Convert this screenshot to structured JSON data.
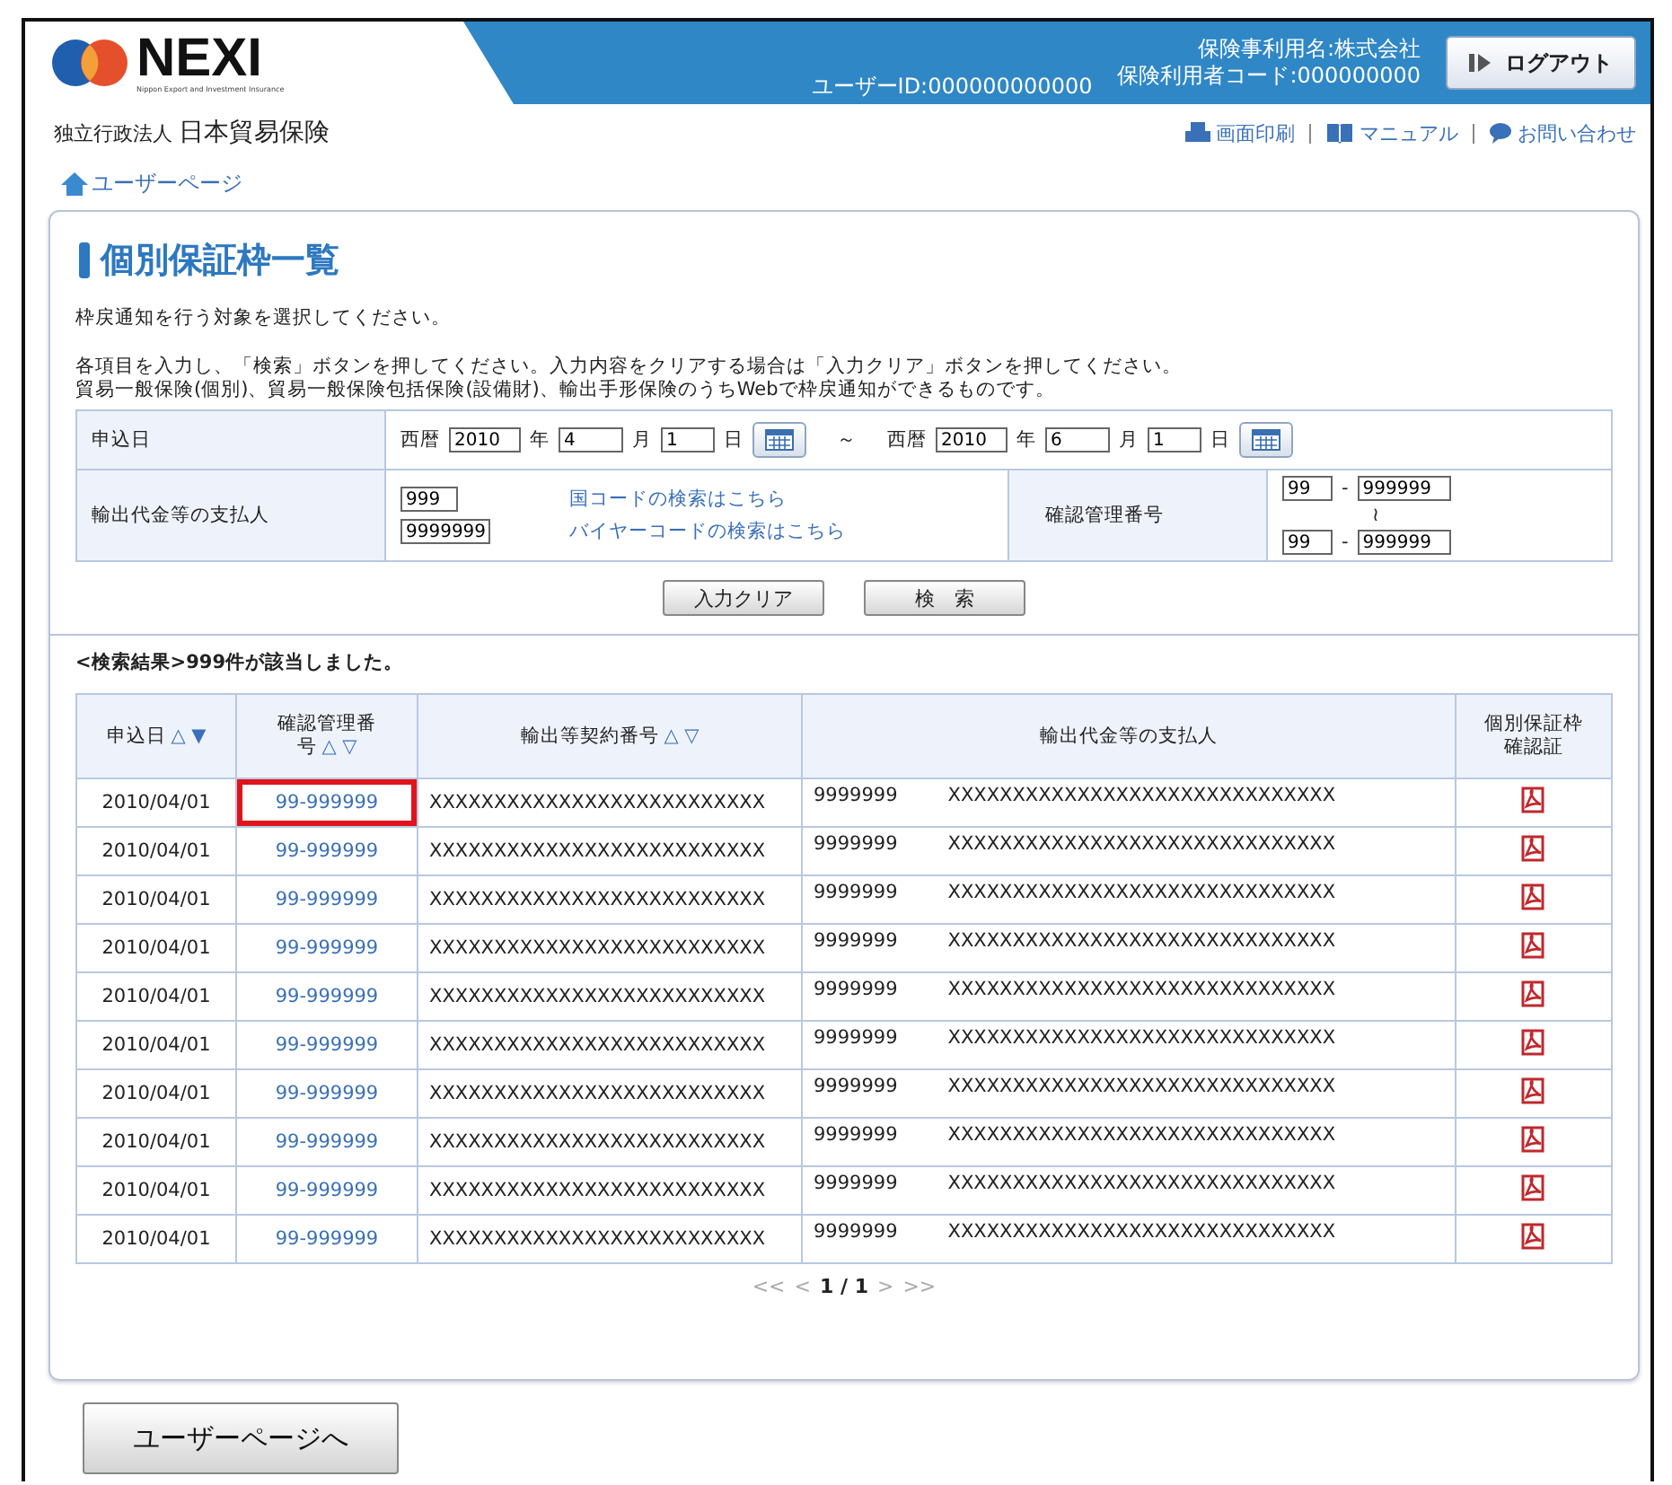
{
  "header": {
    "logo": "NEXI",
    "logo_subtitle": "Nippon Export and Investment Insurance",
    "org_prefix": "独立行政法人",
    "org_name": "日本貿易保険",
    "user_id": "ユーザーID:000000000000",
    "user_name": "保険事利用名:株式会社",
    "user_code": "保険利用者コード:000000000",
    "logout": "ログアウト",
    "links": [
      {
        "kind": "print",
        "label": "画面印刷"
      },
      {
        "kind": "manual",
        "label": "マニュアル"
      },
      {
        "kind": "contact",
        "label": "お問い合わせ"
      }
    ]
  },
  "breadcrumb": "ユーザーページ",
  "title": "個別保証枠一覧",
  "intro": "枠戻通知を行う対象を選択してください。",
  "notes": [
    "各項目を入力し、「検索」ボタンを押してください。入力内容をクリアする場合は「入力クリア」ボタンを押してください。",
    "貿易一般保険(個別)、貿易一般保険包括保険(設備財)、輸出手形保険のうちWebで枠戻通知ができるものです。"
  ],
  "search": {
    "date_label": "申込日",
    "date_from": {
      "era": "西暦",
      "year": "2010",
      "year_unit": "年",
      "month": "4",
      "month_unit": "月",
      "day": "1",
      "day_unit": "日"
    },
    "range_sep": "～",
    "date_to": {
      "era": "西暦",
      "year": "2010",
      "year_unit": "年",
      "month": "6",
      "month_unit": "月",
      "day": "1",
      "day_unit": "日"
    },
    "payer_label": "輸出代金等の支払人",
    "country_code": "999",
    "country_link": "国コードの検索はこちら",
    "buyer_code": "9999999",
    "buyer_link": "バイヤーコードの検索はこちら",
    "confirm_label": "確認管理番号",
    "confirm_from": [
      "99",
      "999999"
    ],
    "confirm_sep": "-",
    "confirm_range": "≀",
    "confirm_to": [
      "99",
      "999999"
    ]
  },
  "buttons": [
    "入力クリア",
    "検　索"
  ],
  "result_summary": "<検索結果>999件が該当しました。",
  "table": {
    "columns": [
      {
        "label": "申込日",
        "sort": "△ ▼"
      },
      {
        "label": "確認管理番号",
        "sort": "△ ▽"
      },
      {
        "label": "輸出等契約番号",
        "sort": "△ ▽"
      },
      {
        "label": "輸出代金等の支払人"
      },
      {
        "label": "個別保証枠確認証"
      }
    ],
    "rows": [
      {
        "date": "2010/04/01",
        "number": "99-999999",
        "contract": "XXXXXXXXXXXXXXXXXXXXXXXXXX",
        "payer_code": "9999999",
        "payer_name": "XXXXXXXXXXXXXXXXXXXXXXXXXXXXXX",
        "highlighted": true
      },
      {
        "date": "2010/04/01",
        "number": "99-999999",
        "contract": "XXXXXXXXXXXXXXXXXXXXXXXXXX",
        "payer_code": "9999999",
        "payer_name": "XXXXXXXXXXXXXXXXXXXXXXXXXXXXXX",
        "highlighted": false
      },
      {
        "date": "2010/04/01",
        "number": "99-999999",
        "contract": "XXXXXXXXXXXXXXXXXXXXXXXXXX",
        "payer_code": "9999999",
        "payer_name": "XXXXXXXXXXXXXXXXXXXXXXXXXXXXXX",
        "highlighted": false
      },
      {
        "date": "2010/04/01",
        "number": "99-999999",
        "contract": "XXXXXXXXXXXXXXXXXXXXXXXXXX",
        "payer_code": "9999999",
        "payer_name": "XXXXXXXXXXXXXXXXXXXXXXXXXXXXXX",
        "highlighted": false
      },
      {
        "date": "2010/04/01",
        "number": "99-999999",
        "contract": "XXXXXXXXXXXXXXXXXXXXXXXXXX",
        "payer_code": "9999999",
        "payer_name": "XXXXXXXXXXXXXXXXXXXXXXXXXXXXXX",
        "highlighted": false
      },
      {
        "date": "2010/04/01",
        "number": "99-999999",
        "contract": "XXXXXXXXXXXXXXXXXXXXXXXXXX",
        "payer_code": "9999999",
        "payer_name": "XXXXXXXXXXXXXXXXXXXXXXXXXXXXXX",
        "highlighted": false
      },
      {
        "date": "2010/04/01",
        "number": "99-999999",
        "contract": "XXXXXXXXXXXXXXXXXXXXXXXXXX",
        "payer_code": "9999999",
        "payer_name": "XXXXXXXXXXXXXXXXXXXXXXXXXXXXXX",
        "highlighted": false
      },
      {
        "date": "2010/04/01",
        "number": "99-999999",
        "contract": "XXXXXXXXXXXXXXXXXXXXXXXXXX",
        "payer_code": "9999999",
        "payer_name": "XXXXXXXXXXXXXXXXXXXXXXXXXXXXXX",
        "highlighted": false
      },
      {
        "date": "2010/04/01",
        "number": "99-999999",
        "contract": "XXXXXXXXXXXXXXXXXXXXXXXXXX",
        "payer_code": "9999999",
        "payer_name": "XXXXXXXXXXXXXXXXXXXXXXXXXXXXXX",
        "highlighted": false
      },
      {
        "date": "2010/04/01",
        "number": "99-999999",
        "contract": "XXXXXXXXXXXXXXXXXXXXXXXXXX",
        "payer_code": "9999999",
        "payer_name": "XXXXXXXXXXXXXXXXXXXXXXXXXXXXXX",
        "highlighted": false
      }
    ]
  },
  "pagination": [
    {
      "label": "<<",
      "disabled": true
    },
    {
      "label": "<",
      "disabled": true
    },
    {
      "label": "1 / 1",
      "disabled": false
    },
    {
      "label": ">",
      "disabled": true
    },
    {
      "label": ">>",
      "disabled": true
    }
  ],
  "back_button": "ユーザーページへ"
}
